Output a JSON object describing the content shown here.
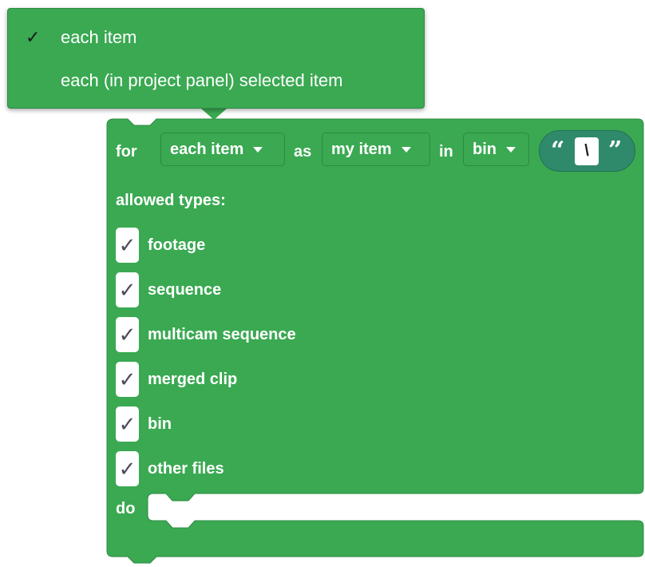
{
  "menu": {
    "items": [
      {
        "label": "each item",
        "checked": true,
        "check_glyph": "✓"
      },
      {
        "label": "each (in project panel) selected item",
        "checked": false,
        "check_glyph": ""
      }
    ]
  },
  "block": {
    "for_label": "for",
    "mode_dropdown": "each item",
    "as_label": "as",
    "var_dropdown": "my item",
    "in_label": "in",
    "source_dropdown": "bin",
    "text_input": {
      "open_quote": "“",
      "value": "\\",
      "close_quote": "”"
    },
    "allowed_types_label": "allowed types:",
    "types": [
      {
        "label": "footage",
        "checked": true,
        "glyph": "✓"
      },
      {
        "label": "sequence",
        "checked": true,
        "glyph": "✓"
      },
      {
        "label": "multicam sequence",
        "checked": true,
        "glyph": "✓"
      },
      {
        "label": "merged clip",
        "checked": true,
        "glyph": "✓"
      },
      {
        "label": "bin",
        "checked": true,
        "glyph": "✓"
      },
      {
        "label": "other files",
        "checked": true,
        "glyph": "✓"
      }
    ],
    "do_label": "do"
  },
  "colors": {
    "block_fill": "#3aa952",
    "block_stroke": "#2d8a42",
    "text_pill": "#2f8a6c"
  }
}
